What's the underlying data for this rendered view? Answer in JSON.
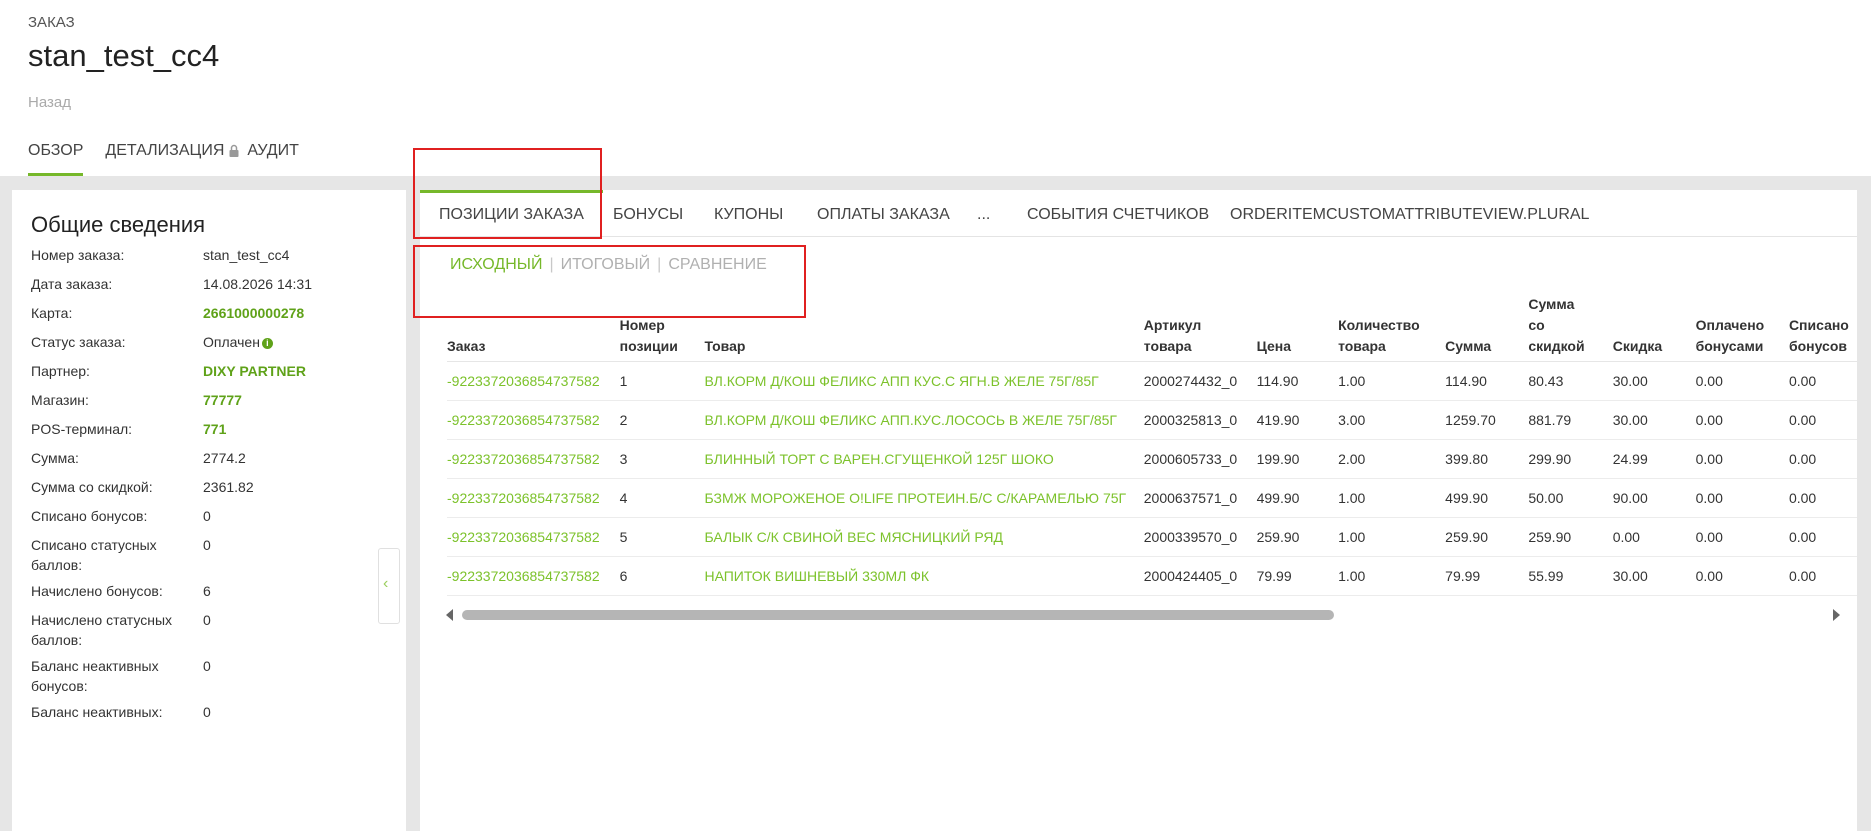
{
  "header": {
    "kind": "ЗАКАЗ",
    "title": "stan_test_cc4",
    "back": "Назад",
    "tabs": [
      {
        "label": "ОБЗОР"
      },
      {
        "label": "ДЕТАЛИЗАЦИЯ"
      },
      {
        "label": "АУДИТ"
      }
    ]
  },
  "summary": {
    "title": "Общие сведения",
    "rows": [
      {
        "label": "Номер заказа:",
        "value": "stan_test_cc4"
      },
      {
        "label": "Дата заказа:",
        "value": "14.08.2026 14:31"
      },
      {
        "label": "Карта:",
        "value": "2661000000278"
      },
      {
        "label": "Статус заказа:",
        "value": "Оплачен",
        "icon": "info-icon"
      },
      {
        "label": "Партнер:",
        "value": "DIXY PARTNER"
      },
      {
        "label": "Магазин:",
        "value": "77777"
      },
      {
        "label": "POS-терминал:",
        "value": "771"
      },
      {
        "label": "Сумма:",
        "value": "2774.2"
      },
      {
        "label": "Сумма со скидкой:",
        "value": "2361.82"
      },
      {
        "label": "Списано бонусов:",
        "value": "0"
      },
      {
        "label": "Списано статусных баллов:",
        "value": "0"
      },
      {
        "label": "Начислено бонусов:",
        "value": "6"
      },
      {
        "label": "Начислено статусных баллов:",
        "value": "0"
      },
      {
        "label": "Баланс неактивных бонусов:",
        "value": "0"
      },
      {
        "label": "Баланс неактивных:",
        "value": "0"
      }
    ]
  },
  "tabs": [
    {
      "label": "ПОЗИЦИИ ЗАКАЗА"
    },
    {
      "label": "БОНУСЫ"
    },
    {
      "label": "КУПОНЫ"
    },
    {
      "label": "ОПЛАТЫ ЗАКАЗА"
    },
    {
      "label": "..."
    },
    {
      "label": "СОБЫТИЯ СЧЕТЧИКОВ"
    },
    {
      "label": "ORDERITEMCUSTOMATTRIBUTEVIEW.PLURAL"
    }
  ],
  "subtabs": [
    {
      "label": "ИСХОДНЫЙ"
    },
    {
      "label": "ИТОГОВЫЙ"
    },
    {
      "label": "СРАВНЕНИЕ"
    }
  ],
  "subtab_separator": "|",
  "table": {
    "columns": [
      [
        "Заказ"
      ],
      [
        "Номер",
        "позиции"
      ],
      [
        "Товар"
      ],
      [
        "Артикул",
        "товара"
      ],
      [
        "Цена"
      ],
      [
        "Количество",
        "товара"
      ],
      [
        "Сумма"
      ],
      [
        "Сумма",
        "со",
        "скидкой"
      ],
      [
        "Скидка"
      ],
      [
        "Оплачено",
        "бонусами"
      ],
      [
        "Списано",
        "бонусов"
      ]
    ],
    "rows": [
      [
        "-9223372036854737582",
        "1",
        "ВЛ.КОРМ Д/КОШ ФЕЛИКС АПП КУС.С ЯГН.В ЖЕЛЕ 75Г/85Г",
        "2000274432_0",
        "114.90",
        "1.00",
        "114.90",
        "80.43",
        "30.00",
        "0.00",
        "0.00"
      ],
      [
        "-9223372036854737582",
        "2",
        "ВЛ.КОРМ Д/КОШ ФЕЛИКС АПП.КУС.ЛОСОСЬ В ЖЕЛЕ 75Г/85Г",
        "2000325813_0",
        "419.90",
        "3.00",
        "1259.70",
        "881.79",
        "30.00",
        "0.00",
        "0.00"
      ],
      [
        "-9223372036854737582",
        "3",
        "БЛИННЫЙ ТОРТ С ВАРЕН.СГУЩЕНКОЙ 125Г ШОКО",
        "2000605733_0",
        "199.90",
        "2.00",
        "399.80",
        "299.90",
        "24.99",
        "0.00",
        "0.00"
      ],
      [
        "-9223372036854737582",
        "4",
        "БЗМЖ МОРОЖЕНОЕ O!LIFE ПРОТЕИН.Б/С С/КАРАМЕЛЬЮ 75Г",
        "2000637571_0",
        "499.90",
        "1.00",
        "499.90",
        "50.00",
        "90.00",
        "0.00",
        "0.00"
      ],
      [
        "-9223372036854737582",
        "5",
        "БАЛЫК С/К СВИНОЙ ВЕС МЯСНИЦКИЙ РЯД",
        "2000339570_0",
        "259.90",
        "1.00",
        "259.90",
        "259.90",
        "0.00",
        "0.00",
        "0.00"
      ],
      [
        "-9223372036854737582",
        "6",
        "НАПИТОК ВИШНЕВЫЙ 330МЛ ФК",
        "2000424405_0",
        "79.99",
        "1.00",
        "79.99",
        "55.99",
        "30.00",
        "0.00",
        "0.00"
      ]
    ]
  },
  "colors": {
    "accent": "#76b82a",
    "link": "#7cc22b",
    "highlight": "#e02020",
    "background": "#e6e6e6"
  }
}
